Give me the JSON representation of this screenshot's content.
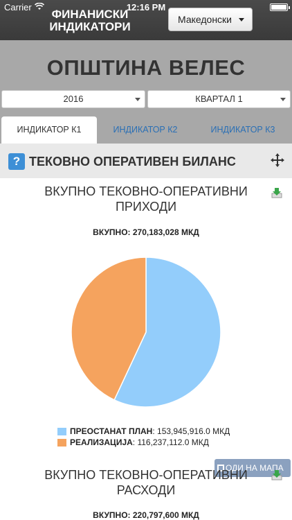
{
  "status_bar": {
    "carrier": "Carrier",
    "time": "12:16 PM"
  },
  "header": {
    "title": "ФИНАНИСКИ ИНДИКАТОРИ",
    "language": "Македонски"
  },
  "municipality": {
    "name": "ОПШТИНА ВЕЛЕС"
  },
  "filters": {
    "year": "2016",
    "quarter": "КВАРТАЛ 1"
  },
  "tabs": [
    {
      "label": "ИНДИКАТОР К1",
      "active": true
    },
    {
      "label": "ИНДИКАТОР К2",
      "active": false
    },
    {
      "label": "ИНДИКАТОР К3",
      "active": false
    }
  ],
  "section": {
    "title": "ТЕКОВНО ОПЕРАТИВЕН БИЛАНС",
    "help_icon": "?"
  },
  "charts": [
    {
      "title": "ВКУПНО ТЕКОВНО-ОПЕРАТИВНИ ПРИХОДИ",
      "total": "ВКУПНО: 270,183,028 МКД"
    },
    {
      "title": "ВКУПНО ТЕКОВНО-ОПЕРАТИВНИ РАСХОДИ",
      "total": "ВКУПНО: 220,797,600 МКД"
    }
  ],
  "legend": [
    {
      "label": "ПРЕОСТАНАТ ПЛАН",
      "value": ": 153,945,916.0 МКД",
      "color": "#93cdfb"
    },
    {
      "label": "РЕАЛИЗАЦИЈА",
      "value": ": 116,237,112.0 МКД",
      "color": "#f5a35e"
    }
  ],
  "map_button": {
    "label": "ОДИ НА МАПА"
  },
  "chart_data": {
    "type": "pie",
    "title": "ВКУПНО ТЕКОВНО-ОПЕРАТИВНИ ПРИХОДИ",
    "categories": [
      "ПРЕОСТАНАТ ПЛАН",
      "РЕАЛИЗАЦИЈА"
    ],
    "values": [
      153945916.0,
      116237112.0
    ],
    "colors": [
      "#93cdfb",
      "#f5a35e"
    ],
    "legend": "bottom"
  }
}
